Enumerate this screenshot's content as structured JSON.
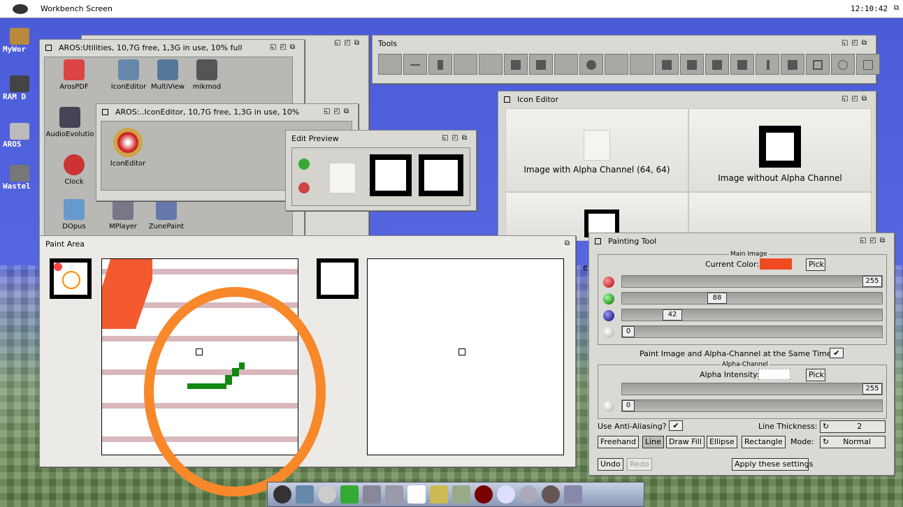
{
  "screen": {
    "title": "Workbench Screen",
    "clock": "12:10:42"
  },
  "desktop": {
    "icons": [
      {
        "label": "MyWor"
      },
      {
        "label": "RAM D"
      },
      {
        "label": "AROS"
      },
      {
        "label": "Wastel"
      }
    ]
  },
  "utilities": {
    "title": "AROS:Utilities, 10,7G free, 1,3G in use, 10% full",
    "icons": [
      {
        "label": "ArosPDF"
      },
      {
        "label": "IconEditor"
      },
      {
        "label": "MultiView"
      },
      {
        "label": "mikmod"
      },
      {
        "label": "AudioEvolutio"
      },
      {
        "label": "Clock"
      },
      {
        "label": "DOpus"
      },
      {
        "label": "MPlayer"
      },
      {
        "label": "ZunePaint"
      }
    ]
  },
  "iconeditor_drawer": {
    "title": "AROS:..IconEditor, 10,7G free, 1,3G in use, 10%",
    "icon": "IconEditor"
  },
  "edit_preview": {
    "title": "Edit Preview"
  },
  "tools": {
    "title": "Tools"
  },
  "icon_editor": {
    "title": "Icon Editor",
    "cells": [
      "Image with Alpha Channel (64, 64)",
      "Image without Alpha Channel",
      "ed"
    ]
  },
  "paint_area": {
    "title": "Paint Area"
  },
  "painting_tool": {
    "title": "Painting Tool",
    "main_image_group": "Main Image",
    "current_color_label": "Current Color:",
    "current_color": "#f04a22",
    "pick": "Pick",
    "red": "255",
    "green": "88",
    "blue": "42",
    "alpha": "0",
    "same_time_label": "Paint Image and Alpha-Channel at the Same Time?",
    "check": "✔",
    "alpha_group": "Alpha-Channel",
    "alpha_intensity_label": "Alpha Intensity:",
    "alpha_value": "255",
    "alpha_value2": "0",
    "anti_alias_label": "Use Anti-Aliasing?",
    "line_thickness_label": "Line Thickness:",
    "line_thickness": "2",
    "mode_label": "Mode:",
    "mode": "Normal",
    "tools": [
      "Freehand",
      "Line",
      "Draw Fill",
      "Ellipse",
      "Rectangle"
    ],
    "undo": "Undo",
    "redo": "Redo",
    "apply": "Apply these settings"
  },
  "dock": {
    "items": [
      "aros",
      "drawer",
      "clock",
      "pen",
      "mail",
      "paint",
      "zune-view",
      "files",
      "brush",
      "sphere",
      "search",
      "gear",
      "game",
      "tv"
    ]
  }
}
